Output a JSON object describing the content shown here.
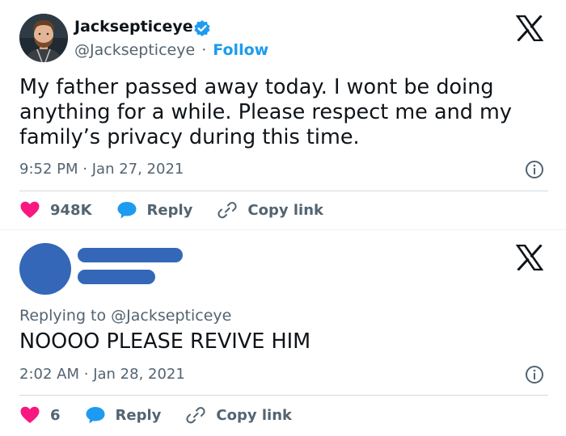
{
  "tweet": {
    "display_name": "Jacksepticeye",
    "handle": "@Jacksepticeye",
    "separator": "·",
    "follow_label": "Follow",
    "text": "My father passed away today. I wont be doing anything for a while. Please respect me and my family’s privacy during this time.",
    "time": "9:52 PM",
    "date": "Jan 27, 2021",
    "likes": "948K",
    "reply_label": "Reply",
    "copy_link_label": "Copy link",
    "icons": [
      "verified-badge-icon",
      "x-logo-icon",
      "info-icon",
      "heart-icon",
      "reply-bubble-icon",
      "link-icon"
    ]
  },
  "reply": {
    "replying_to_prefix": "Replying to",
    "replying_to_handle": "@Jacksepticeye",
    "text": "NOOOO PLEASE REVIVE HIM",
    "time": "2:02 AM",
    "date": "Jan 28, 2021",
    "likes": "6",
    "reply_label": "Reply",
    "copy_link_label": "Copy link"
  },
  "colors": {
    "like_red": "#f91880",
    "reply_blue": "#1d9bf0",
    "text_primary": "#0f1419",
    "text_secondary": "#536471",
    "redaction_blue": "#3467b7"
  }
}
